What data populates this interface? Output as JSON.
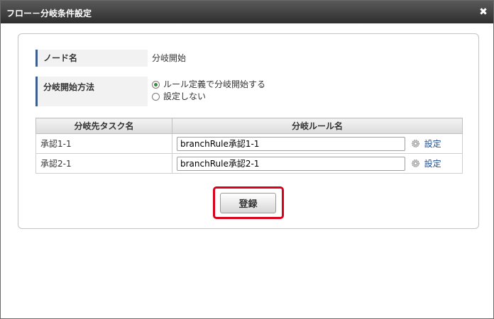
{
  "dialog": {
    "title": "フロー－分岐条件設定",
    "close_symbol": "✖"
  },
  "node_row": {
    "label": "ノード名",
    "value": "分岐開始"
  },
  "method_row": {
    "label": "分岐開始方法",
    "options": [
      {
        "label": "ルール定義で分岐開始する",
        "selected": true
      },
      {
        "label": "設定しない",
        "selected": false
      }
    ]
  },
  "table": {
    "headers": [
      "分岐先タスク名",
      "分岐ルール名"
    ],
    "rows": [
      {
        "task": "承認1-1",
        "rule": "branchRule承認1-1",
        "link": "設定"
      },
      {
        "task": "承認2-1",
        "rule": "branchRule承認2-1",
        "link": "設定"
      }
    ]
  },
  "actions": {
    "register_label": "登録"
  },
  "colors": {
    "title_bar": "#3a3a3a",
    "label_accent": "#3c5d8e",
    "highlight": "#d9001b",
    "link": "#1b4d96"
  },
  "icons": {
    "close": "close-icon",
    "settings": "gear-icon"
  }
}
